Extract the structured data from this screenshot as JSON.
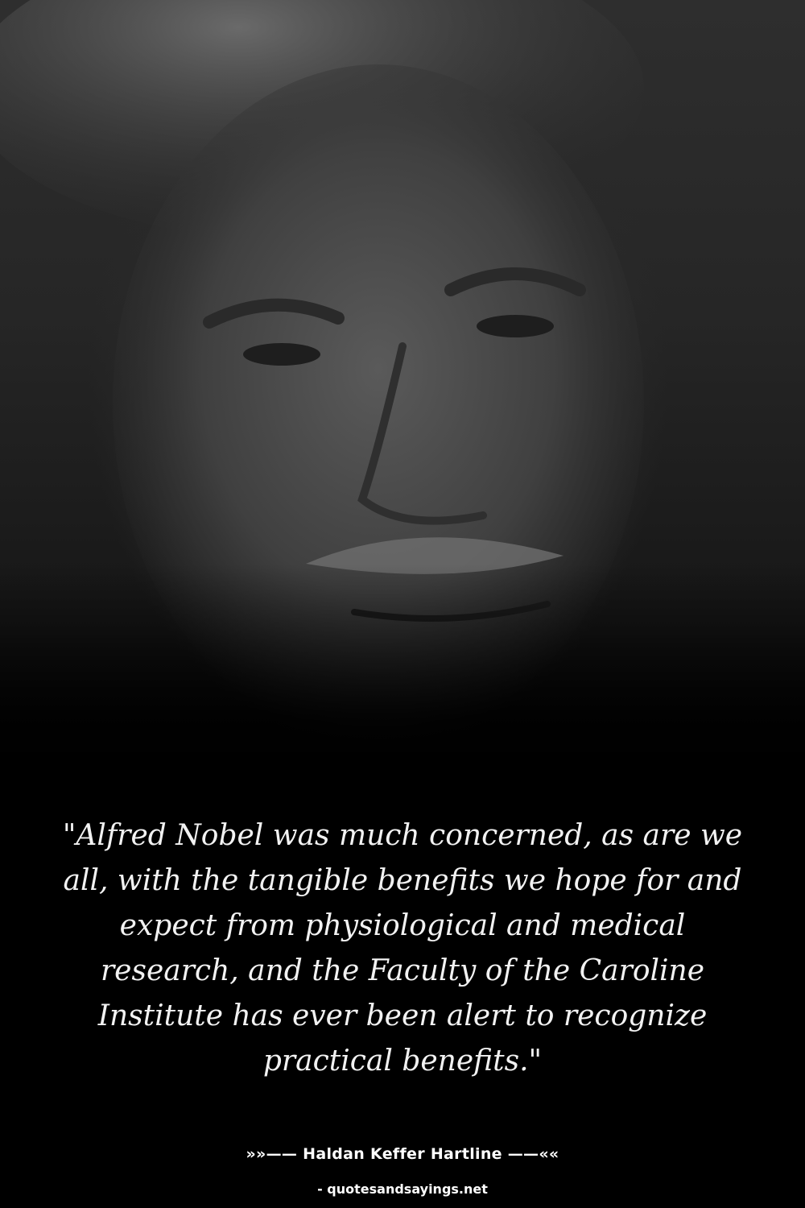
{
  "quote": {
    "text": "\"Alfred Nobel was much concerned, as are we all, with the tangible benefits we hope for and expect from physiological and medical research, and the Faculty of the Caroline Institute has ever been alert to recognize practical benefits.\""
  },
  "author": {
    "line": "»»—— Haldan Keffer Hartline ——««"
  },
  "footer": {
    "site": "- quotesandsayings.net"
  },
  "colors": {
    "background": "#000000",
    "text": "#f2f2f2"
  }
}
